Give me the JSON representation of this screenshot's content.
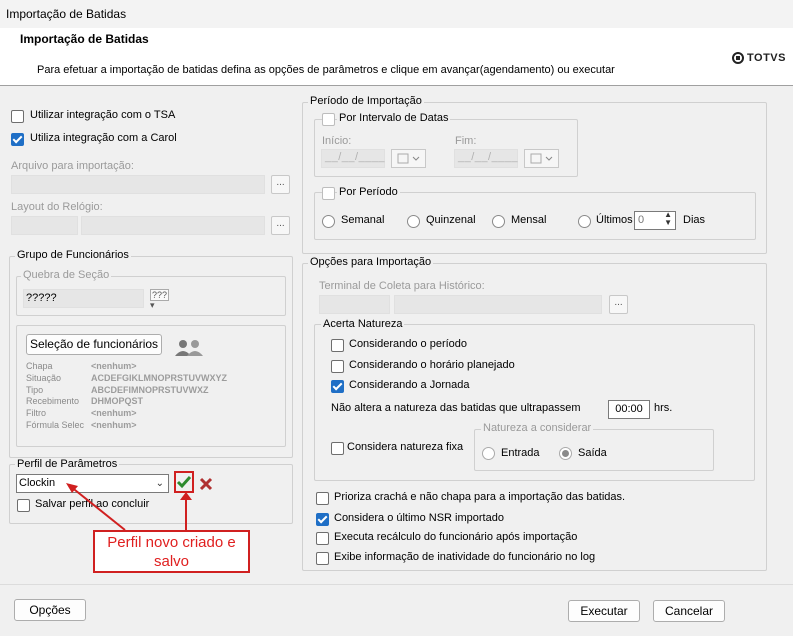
{
  "window": {
    "title": "Importação de Batidas"
  },
  "header": {
    "title": "Importação de Batidas",
    "description": "Para efetuar a importação de batidas defina as opções de parâmetros e clique em avançar(agendamento) ou executar",
    "logo_text": "TOTVS"
  },
  "left": {
    "tsa_label": "Utilizar integração com o TSA",
    "tsa_checked": false,
    "carol_label": "Utiliza integração com a Carol",
    "carol_checked": true,
    "arquivo_label": "Arquivo para importação:",
    "layout_label": "Layout do Relógio:",
    "dots": "..."
  },
  "grupo": {
    "legend": "Grupo de Funcionários",
    "quebra_legend": "Quebra de Seção",
    "quebra_value": "?????",
    "quebra_icon_text": "???",
    "selecao_button": "Seleção de funcionários",
    "rows": [
      {
        "label": "Chapa",
        "value": "<nenhum>"
      },
      {
        "label": "Situação",
        "value": "ACDEFGIKLMNOPRSTUVWXYZ"
      },
      {
        "label": "Tipo",
        "value": "ABCDEFIMNOPRSTUVWXZ"
      },
      {
        "label": "Recebimento",
        "value": "DHMOPQST"
      },
      {
        "label": "Filtro",
        "value": "<nenhum>"
      },
      {
        "label": "Fórmula Selec",
        "value": "<nenhum>"
      }
    ]
  },
  "perfil": {
    "legend": "Perfil de Parâmetros",
    "selected": "Clockin",
    "salvar_label": "Salvar perfil ao concluir",
    "salvar_checked": false
  },
  "annotation": {
    "text": "Perfil novo criado e salvo"
  },
  "periodo": {
    "legend": "Período de Importação",
    "intervalo_label": "Por Intervalo de Datas",
    "inicio_label": "Início:",
    "fim_label": "Fim:",
    "date_mask": "__/__/____",
    "por_periodo_label": "Por Período",
    "radios": [
      "Semanal",
      "Quinzenal",
      "Mensal",
      "Últimos"
    ],
    "ultimos_value": "0",
    "dias_label": "Dias"
  },
  "opcoes": {
    "legend": "Opções para Importação",
    "terminal_label": "Terminal de Coleta para Histórico:",
    "dots": "...",
    "acerta_legend": "Acerta Natureza",
    "acerta": [
      {
        "label": "Considerando o período",
        "checked": false
      },
      {
        "label": "Considerando o horário planejado",
        "checked": false
      },
      {
        "label": "Considerando a Jornada",
        "checked": true
      }
    ],
    "nao_altera_label": "Não altera a natureza das batidas que ultrapassem",
    "hrs_value": "00:00",
    "hrs_label": "hrs.",
    "natureza_fixa_label": "Considera natureza fixa",
    "natureza_legend": "Natureza a considerar",
    "entrada_label": "Entrada",
    "saida_label": "Saída",
    "extra": [
      {
        "label": "Prioriza crachá e não chapa para a importação das batidas.",
        "checked": false
      },
      {
        "label": "Considera o último NSR importado",
        "checked": true
      },
      {
        "label": "Executa recálculo do funcionário após importação",
        "checked": false
      },
      {
        "label": "Exibe informação de inatividade do funcionário no log",
        "checked": false
      }
    ]
  },
  "footer": {
    "opcoes_button": "Opções",
    "executar_button": "Executar",
    "cancelar_button": "Cancelar"
  },
  "colors": {
    "accent": "#1f6fc6",
    "annotation": "#d02020",
    "confirm": "#2e8b2e",
    "cancel": "#b03030"
  }
}
